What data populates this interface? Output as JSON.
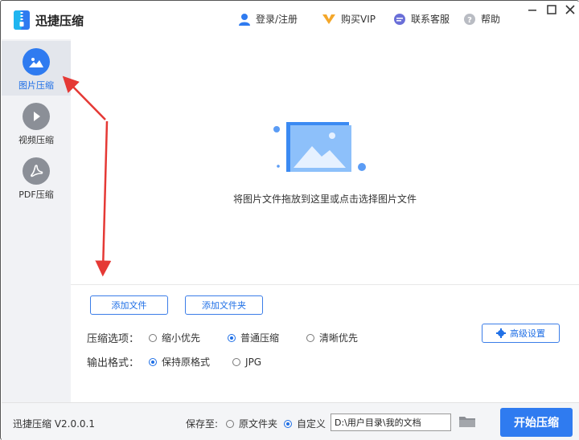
{
  "app": {
    "title": "迅捷压缩",
    "version": "迅捷压缩 V2.0.0.1"
  },
  "header": {
    "login": "登录/注册",
    "vip": "购买VIP",
    "service": "联系客服",
    "help": "帮助"
  },
  "sidebar": {
    "items": [
      {
        "label": "图片压缩",
        "icon": "image-icon",
        "active": true
      },
      {
        "label": "视频压缩",
        "icon": "play-icon",
        "active": false
      },
      {
        "label": "PDF压缩",
        "icon": "pdf-icon",
        "active": false
      }
    ]
  },
  "drop": {
    "hint": "将图片文件拖放到这里或点击选择图片文件"
  },
  "buttons": {
    "add_file": "添加文件",
    "add_folder": "添加文件夹",
    "advanced": "高级设置",
    "start": "开始压缩"
  },
  "compress": {
    "label": "压缩选项：",
    "options": [
      "缩小优先",
      "普通压缩",
      "清晰优先"
    ],
    "selected": "普通压缩"
  },
  "format": {
    "label": "输出格式：",
    "options": [
      "保持原格式",
      "JPG"
    ],
    "selected": "保持原格式"
  },
  "save": {
    "label": "保存至:",
    "options": [
      "原文件夹",
      "自定义"
    ],
    "selected": "自定义",
    "path": "D:\\用户目录\\我的文档"
  },
  "colors": {
    "accent": "#2f7bf0",
    "arrow": "#e53935"
  }
}
